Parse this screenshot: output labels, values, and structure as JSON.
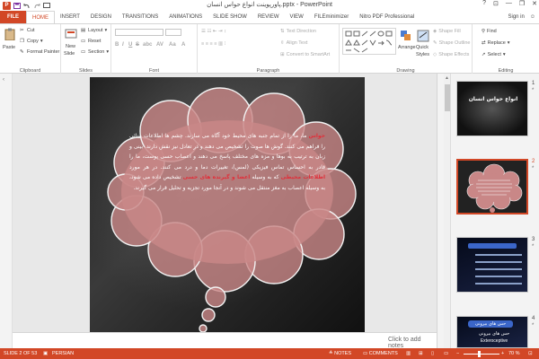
{
  "titlebar": {
    "title": "پاورپوینت انواع حواس انسان.pptx - PowerPoint",
    "help": "?",
    "minimize": "—",
    "restore": "❐",
    "close": "✕"
  },
  "tabs": [
    "FILE",
    "HOME",
    "INSERT",
    "DESIGN",
    "TRANSITIONS",
    "ANIMATIONS",
    "SLIDE SHOW",
    "REVIEW",
    "VIEW",
    "FILEminimizer",
    "Nitro PDF Professional"
  ],
  "signin": "Sign in",
  "ribbon": {
    "clipboard": {
      "label": "Clipboard",
      "paste": "Paste",
      "cut": "Cut",
      "copy": "Copy",
      "format_painter": "Format Painter"
    },
    "slides": {
      "label": "Slides",
      "new_slide": "New",
      "new_slide2": "Slide",
      "layout": "Layout",
      "reset": "Reset",
      "section": "Section"
    },
    "font": {
      "label": "Font",
      "bold": "B",
      "italic": "I",
      "underline": "U",
      "strike": "S",
      "shadow": "abc",
      "aa": "AV",
      "case": "Aa",
      "color": "A"
    },
    "paragraph": {
      "label": "Paragraph",
      "text_direction": "Text Direction",
      "align_text": "Align Text",
      "convert": "Convert to SmartArt"
    },
    "drawing": {
      "label": "Drawing",
      "arrange": "Arrange",
      "quick_styles": "Quick",
      "quick_styles2": "Styles",
      "shape_fill": "Shape Fill",
      "shape_outline": "Shape Outline",
      "shape_effects": "Shape Effects"
    },
    "editing": {
      "label": "Editing",
      "find": "Find",
      "replace": "Replace",
      "select": "Select"
    }
  },
  "slide": {
    "text_parts": [
      {
        "t": "حواس",
        "hl": true
      },
      {
        "t": " ما، ما را از تمام جنبه های محیط خود آگاه       می سازند. چشم ها اطلاعات بینائی را فراهم می کنند. گوش ها صوت را تشخیص می دهند و در تعادل نیز نقش دارند. بینی و زبان به ترتیب به بوها و مزه های مختلف پاسخ می دهند و اعصاب حسی پوست، ما را قادر به احساس تماس فیزیکی (لمس)، تغییرات دما و درد      می کنند. در هر مورد ",
        "hl": false
      },
      {
        "t": "اطلاعات محیطی",
        "hl": true
      },
      {
        "t": " که به وسیله ",
        "hl": false
      },
      {
        "t": "اعضا و گیرنده های حسی",
        "hl": true
      },
      {
        "t": " تشخیص داده می شود، به وسیله اعصاب به مغز منتقل می شوند و در آنجا مورد تجزیه و تحلیل قرار می گیرند.",
        "hl": false
      }
    ]
  },
  "notes_placeholder": "Click to add notes",
  "thumbnails": [
    {
      "num": "1",
      "star": "*",
      "title": "انواع حواس انسان"
    },
    {
      "num": "2",
      "star": "*"
    },
    {
      "num": "3",
      "star": "*"
    },
    {
      "num": "4",
      "star": "*",
      "pill": "حس های بیرونی",
      "line1": "حس های بیرونی",
      "line2": "Exteroceptive"
    }
  ],
  "status": {
    "slide": "SLIDE 2 OF 53",
    "language": "PERSIAN",
    "notes": "NOTES",
    "comments": "COMMENTS",
    "zoom": "70 %"
  },
  "colors": {
    "accent": "#d24726",
    "highlight_text": "#e0303a",
    "cloud_fill": "#c98787"
  }
}
